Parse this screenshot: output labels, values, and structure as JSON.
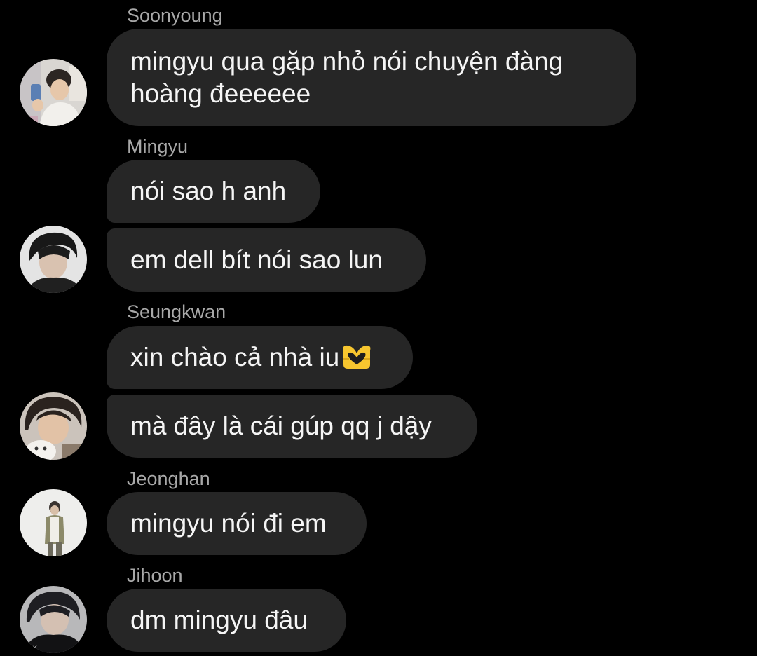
{
  "messages": [
    {
      "sender": "Soonyoung",
      "bubbles": [
        "mingyu qua gặp nhỏ nói chuyện đàng hoàng đeeeeee"
      ]
    },
    {
      "sender": "Mingyu",
      "bubbles": [
        "nói sao h anh",
        "em dell bít nói sao lun"
      ]
    },
    {
      "sender": "Seungkwan",
      "bubbles": [
        "xin chào cả nhà iu",
        "mà đây là cái gúp qq j dậy"
      ]
    },
    {
      "sender": "Jeonghan",
      "bubbles": [
        "mingyu nói đi em"
      ]
    },
    {
      "sender": "Jihoon",
      "bubbles": [
        "dm mingyu đâu"
      ]
    }
  ],
  "emoji": {
    "after_bubble": "heart-hands-emoji",
    "color": "#f7c62f"
  },
  "colors": {
    "background": "#000000",
    "bubble": "#262626",
    "bubble_text": "#f5f5f5",
    "sender_text": "#a8a8a8"
  },
  "avatars": [
    "soonyoung-avatar",
    "mingyu-avatar",
    "seungkwan-avatar",
    "jeonghan-avatar",
    "jihoon-avatar"
  ]
}
